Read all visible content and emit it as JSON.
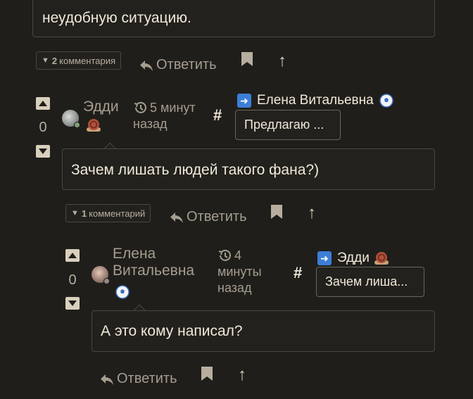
{
  "thread": {
    "top_comment": {
      "text_tail": "неудобную ситуацию.",
      "replies_count": "2",
      "replies_label": "комментария",
      "reply_label": "Ответить"
    },
    "comment_1": {
      "score": "0",
      "author": "Эдди",
      "author_emoji": "snail",
      "time": "5 минут назад",
      "hash": "#",
      "reply_to_name": "Елена Витальевна",
      "reply_to_emoji": "soccer-ball",
      "quote": "Предлагаю ...",
      "text": "Зачем лишать людей такого фана?)",
      "replies_count": "1",
      "replies_label": "комментарий",
      "reply_label": "Ответить"
    },
    "comment_2": {
      "score": "0",
      "author": "Елена Витальевна",
      "author_emoji": "soccer-ball",
      "time": "4 минуты назад",
      "hash": "#",
      "reply_to_name": "Эдди",
      "reply_to_emoji": "snail",
      "quote": "Зачем лиша...",
      "text": "А это кому написал?",
      "reply_label": "Ответить"
    }
  },
  "colors": {
    "background": "#201e1b",
    "text": "#f0e8d8",
    "muted": "#a59d90",
    "vote_button": "#d8cfbc",
    "arrow_badge": "#3d7fd6"
  },
  "icons": [
    "reply-icon",
    "bookmark-icon",
    "up-arrow-icon",
    "vote-up-icon",
    "vote-down-icon",
    "history-icon",
    "right-arrow-icon",
    "snail-emoji-icon",
    "soccer-ball-emoji-icon"
  ]
}
